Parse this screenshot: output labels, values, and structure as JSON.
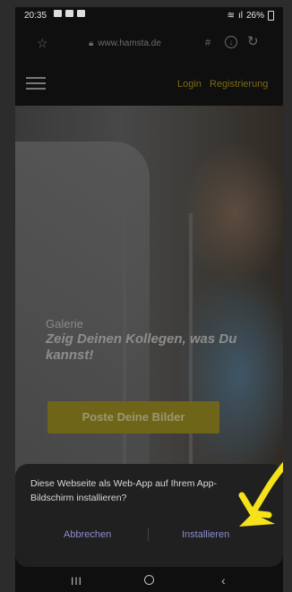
{
  "status_bar": {
    "time": "20:35",
    "battery": "26%"
  },
  "browser": {
    "url": "www.hamsta.de",
    "hash": "#"
  },
  "site_header": {
    "login_label": "Login",
    "register_label": "Registrierung"
  },
  "hero": {
    "section_label": "Galerie",
    "headline": "Zeig Deinen Kollegen, was Du kannst!",
    "cta_label": "Poste Deine Bilder"
  },
  "install_dialog": {
    "message": "Diese Webseite als Web-App auf Ihrem App-Bildschirm installieren?",
    "cancel_label": "Abbrechen",
    "install_label": "Installieren"
  },
  "colors": {
    "accent_yellow": "#6f6519",
    "dialog_button": "#8c8ccf",
    "arrow": "#f6e21b"
  }
}
